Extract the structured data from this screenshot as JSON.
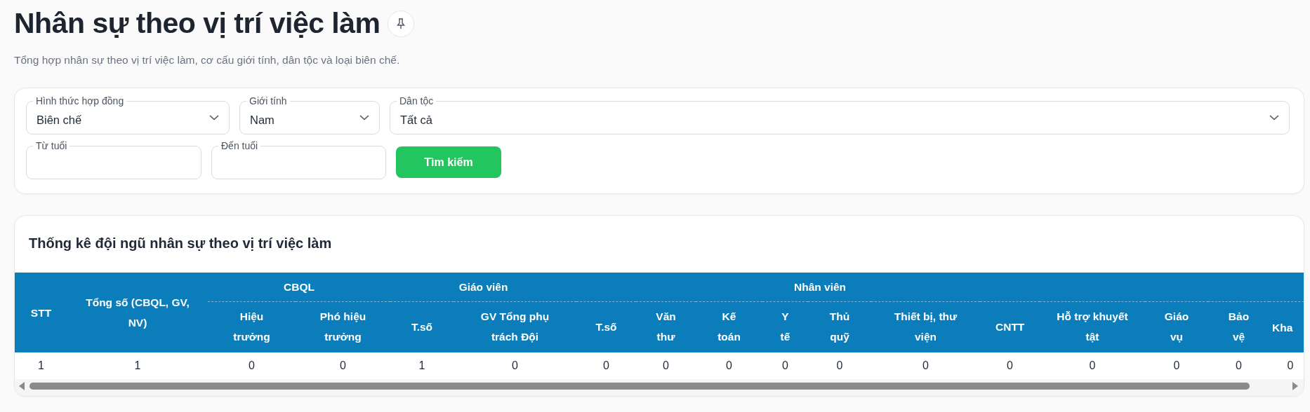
{
  "page": {
    "title": "Nhân sự theo vị trí việc làm",
    "subtitle": "Tổng hợp nhân sự theo vị trí việc làm, cơ cấu giới tính, dân tộc và loại biên chế."
  },
  "filters": {
    "selects": [
      {
        "label": "Hình thức hợp đồng",
        "value": "Biên chế"
      },
      {
        "label": "Giới tính",
        "value": "Nam"
      },
      {
        "label": "Dân tộc",
        "value": "Tất cả"
      }
    ],
    "inputs": [
      {
        "label": "Từ tuổi"
      },
      {
        "label": "Đến tuổi"
      }
    ],
    "search_button": "Tìm kiếm"
  },
  "table": {
    "title": "Thống kê đội ngũ nhân sự theo vị trí việc làm",
    "single_columns": [
      "STT",
      "Tổng số (CBQL, GV, NV)"
    ],
    "groups": [
      {
        "label": "CBQL",
        "columns": [
          "Hiệu trưởng",
          "Phó hiệu trưởng"
        ]
      },
      {
        "label": "Giáo viên",
        "columns": [
          "T.số",
          "GV Tổng phụ trách Đội"
        ]
      },
      {
        "label": "Nhân viên",
        "columns": [
          "T.số",
          "Văn thư",
          "Kế toán",
          "Y tế",
          "Thủ quỹ",
          "Thiết bị, thư viện",
          "CNTT",
          "Hỗ trợ khuyết tật",
          "Giáo vụ",
          "Bảo vệ",
          "Kha"
        ]
      }
    ],
    "rows": [
      [
        "1",
        "1",
        "0",
        "0",
        "1",
        "0",
        "0",
        "0",
        "0",
        "0",
        "0",
        "0",
        "0",
        "0",
        "0",
        "0",
        "0"
      ]
    ]
  }
}
